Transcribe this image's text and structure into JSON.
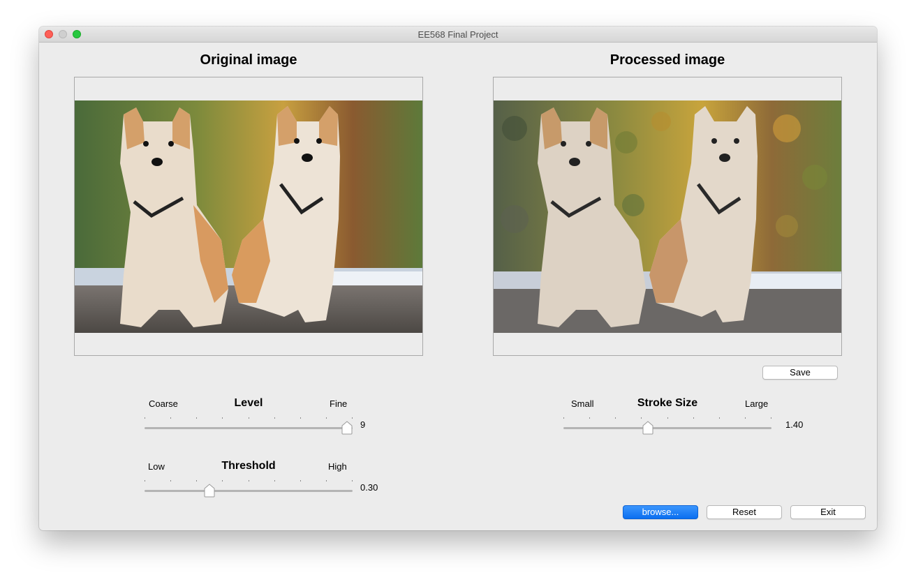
{
  "window": {
    "title": "EE568 Final Project"
  },
  "panels": {
    "original_title": "Original image",
    "processed_title": "Processed image"
  },
  "sliders": {
    "level": {
      "title": "Level",
      "min_label": "Coarse",
      "max_label": "Fine",
      "value": "9",
      "position": 1.0
    },
    "threshold": {
      "title": "Threshold",
      "min_label": "Low",
      "max_label": "High",
      "value": "0.30",
      "position": 0.3
    },
    "stroke_size": {
      "title": "Stroke Size",
      "min_label": "Small",
      "max_label": "Large",
      "value": "1.40",
      "position": 0.4
    }
  },
  "buttons": {
    "save": "Save",
    "browse": "browse...",
    "reset": "Reset",
    "exit": "Exit"
  },
  "colors": {
    "accent": "#0a6ff0"
  }
}
